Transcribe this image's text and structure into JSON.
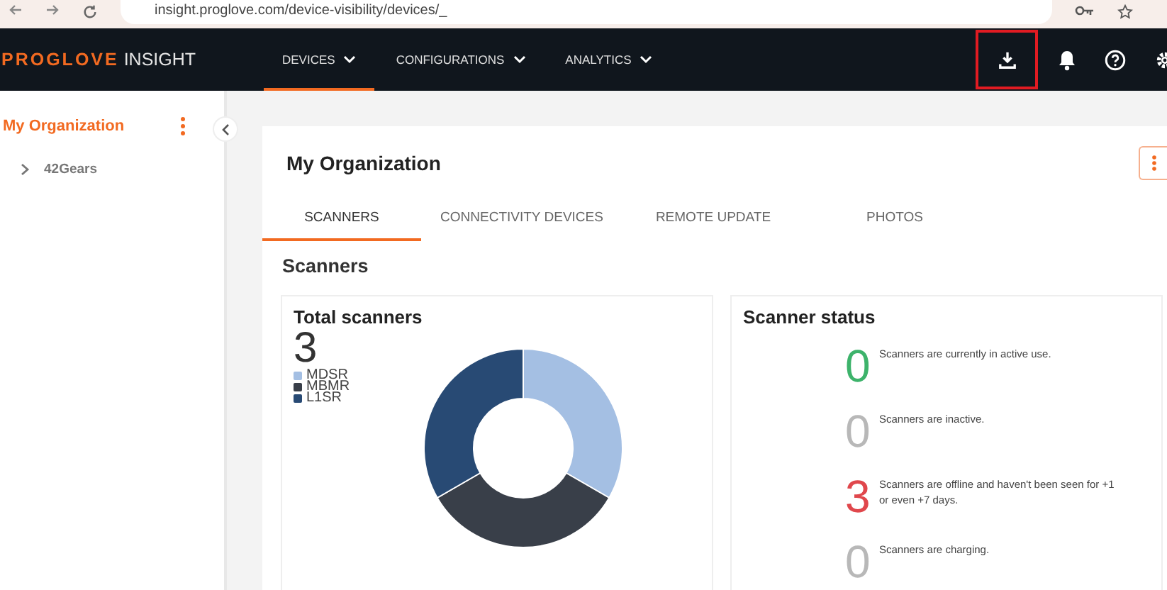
{
  "browser": {
    "url": "insight.proglove.com/device-visibility/devices/_"
  },
  "header": {
    "logo_brand": "PROGLOVE",
    "logo_product": "INSIGHT",
    "nav": [
      {
        "label": "DEVICES",
        "selected": true
      },
      {
        "label": "CONFIGURATIONS",
        "selected": false
      },
      {
        "label": "ANALYTICS",
        "selected": false
      }
    ]
  },
  "sidebar": {
    "root": "My Organization",
    "items": [
      {
        "label": "42Gears",
        "expanded": false
      }
    ]
  },
  "page": {
    "title": "My Organization",
    "tabs": [
      {
        "label": "SCANNERS",
        "selected": true
      },
      {
        "label": "CONNECTIVITY DEVICES",
        "selected": false
      },
      {
        "label": "REMOTE UPDATE",
        "selected": false
      },
      {
        "label": "PHOTOS",
        "selected": false
      }
    ],
    "section": "Scanners",
    "total": {
      "title": "Total scanners",
      "count": "3",
      "legend": [
        {
          "label": "MDSR",
          "color": "#a4bfe3"
        },
        {
          "label": "MBMR",
          "color": "#393f49"
        },
        {
          "label": "L1SR",
          "color": "#284a74"
        }
      ]
    },
    "status": {
      "title": "Scanner status",
      "items": [
        {
          "count": "0",
          "text": "Scanners are currently in active use.",
          "color": "#3db36b"
        },
        {
          "count": "0",
          "text": "Scanners are inactive.",
          "color": "#b8b8b8"
        },
        {
          "count": "3",
          "text": "Scanners are offline and haven't been seen for +1 or even +7 days.",
          "color": "#e0474c"
        },
        {
          "count": "0",
          "text": "Scanners are charging.",
          "color": "#b8b8b8"
        }
      ]
    }
  }
}
